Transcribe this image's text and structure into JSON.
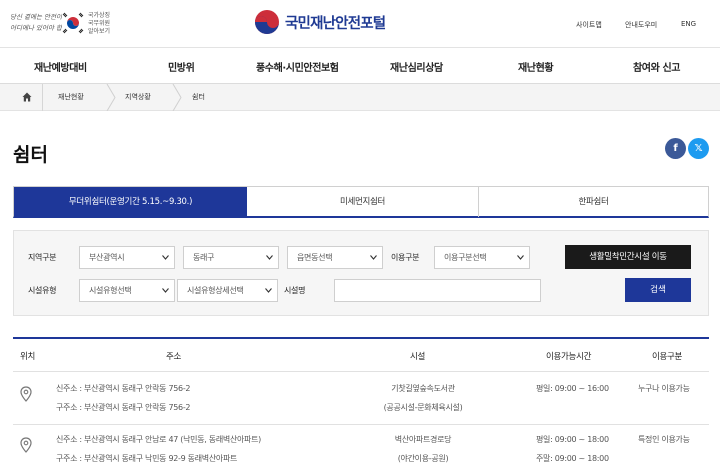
{
  "header": {
    "slogan": [
      "당신 곁에는 안전이,",
      "어디에나 있어야 합니다"
    ],
    "gov_text": [
      "국가상징",
      "국무위원",
      "알아보기"
    ],
    "portal_name": "국민재난안전포털",
    "util": [
      "사이트맵",
      "안내도우미",
      "ENG"
    ]
  },
  "gnb": [
    "재난예방대비",
    "민방위",
    "풍수해·시민안전보험",
    "재난심리상담",
    "재난현황",
    "참여와 신고"
  ],
  "breadcrumb": [
    "재난현황",
    "지역상황",
    "쉼터"
  ],
  "page_title": "쉼터",
  "share": {
    "facebook": "f",
    "x": "𝕏"
  },
  "tabs": [
    "무더위쉼터(운영기간 5.15.~9.30.)",
    "미세먼지쉼터",
    "한파쉼터"
  ],
  "search": {
    "region_label": "지역구분",
    "city": "부산광역시",
    "district": "동래구",
    "dong": "읍면동선택",
    "use_label": "이용구분",
    "use": "이용구분선택",
    "facility_label": "시설유형",
    "facility_type": "시설유형선택",
    "facility_detail": "시설유형상세선택",
    "name_label": "시설명",
    "name_value": "",
    "move_button": "생활밀착민간시설 이동",
    "search_button": "검색"
  },
  "table": {
    "headers": [
      "위치",
      "주소",
      "시설",
      "이용가능시간",
      "이용구분"
    ],
    "rows": [
      {
        "new_addr": "신주소 : 부산광역시 동래구 안락동 756-2",
        "old_addr": "구주소 : 부산광역시 동래구 안락동 756-2",
        "facility": "기찻길옆숲속도서관",
        "facility_type": "(공공시설-문화체육시설)",
        "time1": "평일: 09:00 ~ 16:00",
        "time2": "",
        "use": "누구나 이용가능"
      },
      {
        "new_addr": "신주소 : 부산광역시 동래구 안남로 47 (낙민동, 동래벽산아파트)",
        "old_addr": "구주소 : 부산광역시 동래구 낙민동 92-9 동래벽산아파트",
        "facility": "벽산아파트경로당",
        "facility_type": "(야간이용-공원)",
        "time1": "평일: 09:00 ~ 18:00",
        "time2": "주말: 09:00 ~ 18:00",
        "use": "특정인 이용가능"
      }
    ]
  },
  "colors": {
    "primary": "#1e3799",
    "dark_button": "#1a1a1a",
    "facebook": "#3b5998",
    "x": "#1d9bf0"
  }
}
